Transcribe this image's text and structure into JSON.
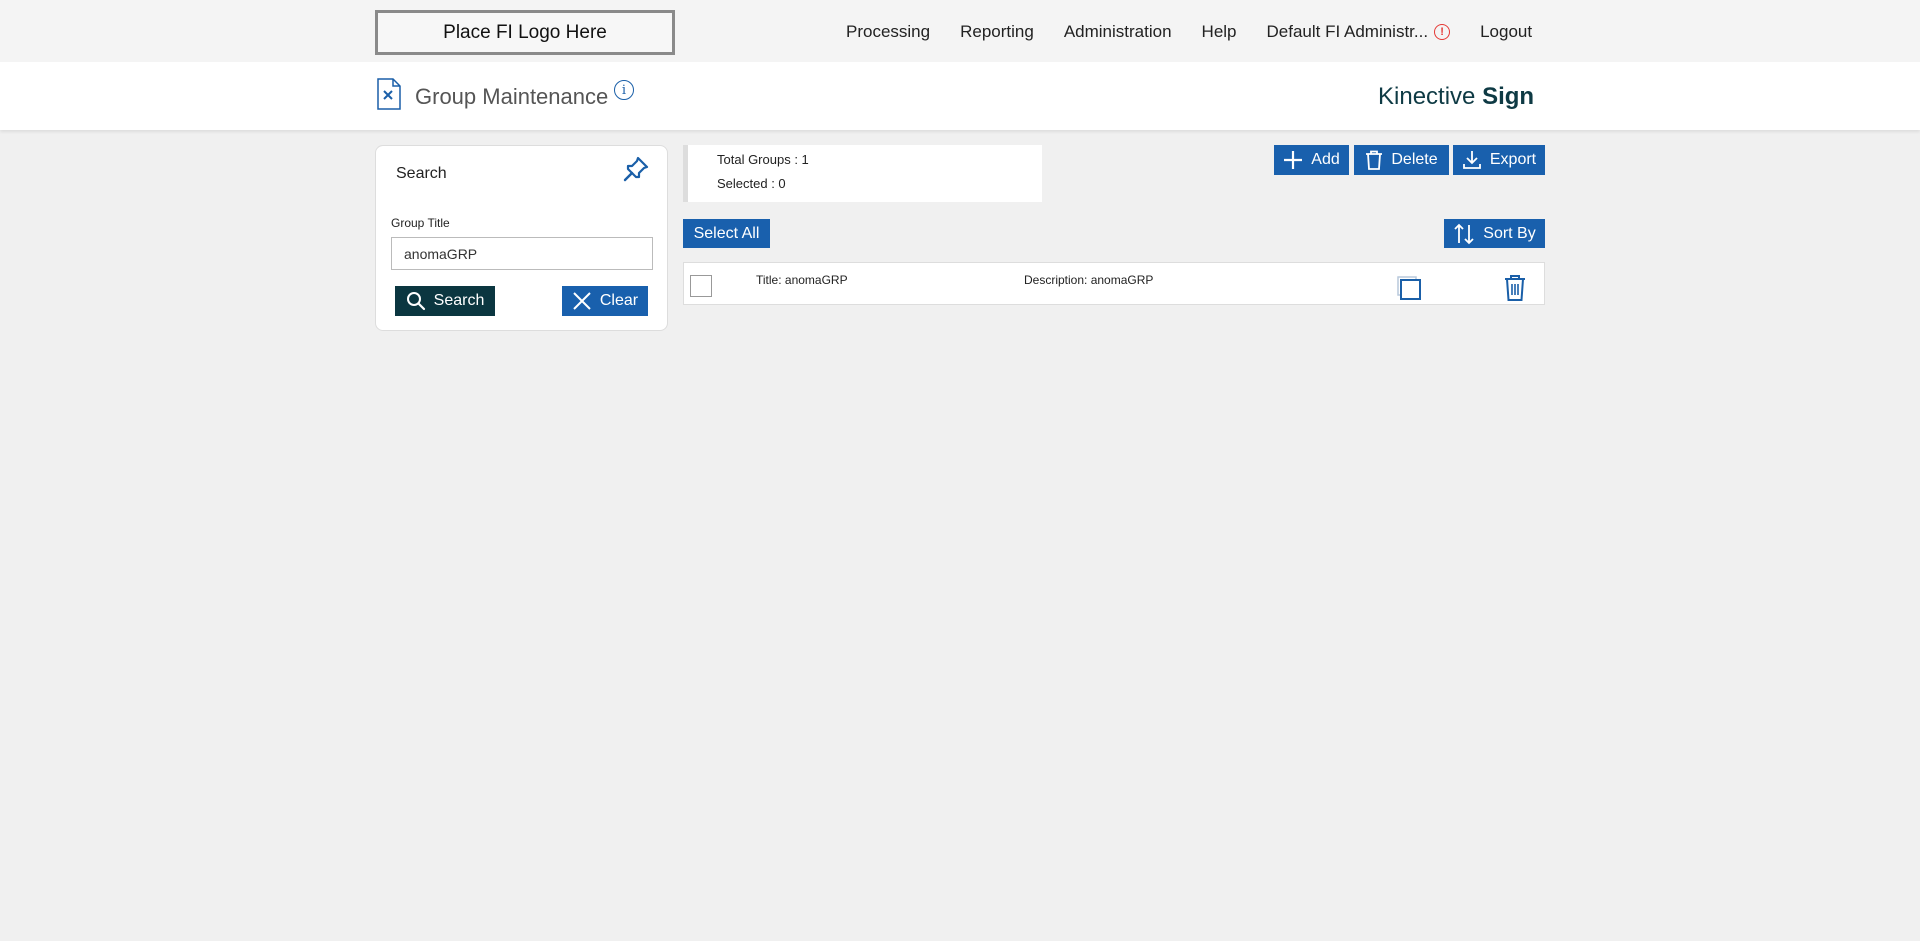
{
  "header": {
    "logo_text": "Place FI Logo Here",
    "nav": [
      "Processing",
      "Reporting",
      "Administration",
      "Help",
      "Default FI Administr...",
      "Logout"
    ],
    "alert_icon": "alert-circle-icon"
  },
  "titlebar": {
    "page_title": "Group Maintenance",
    "brand_light": "Kinective",
    "brand_bold": "Sign"
  },
  "search": {
    "title": "Search",
    "field_label": "Group Title",
    "field_value": "anomaGRP",
    "search_label": "Search",
    "clear_label": "Clear"
  },
  "summary": {
    "total_groups": "Total Groups : 1",
    "selected": "Selected : 0"
  },
  "actions": {
    "add": "Add",
    "delete": "Delete",
    "export": "Export",
    "select_all": "Select All",
    "sort_by": "Sort By"
  },
  "results": [
    {
      "title": "Title:  anomaGRP",
      "description": "Description: anomaGRP"
    }
  ],
  "colors": {
    "primary": "#1960ad",
    "dark": "#0b3640",
    "alert": "#e53935"
  }
}
